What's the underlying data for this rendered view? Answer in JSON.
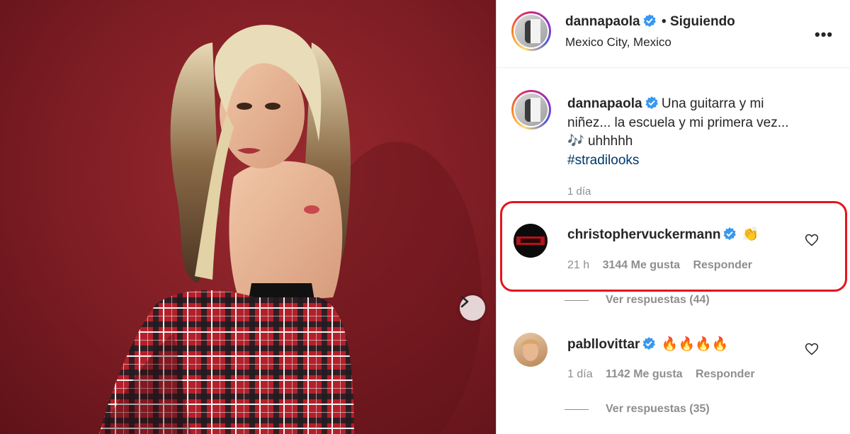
{
  "post": {
    "author": "dannapaola",
    "follow_status": "• Siguiendo",
    "location": "Mexico City, Mexico",
    "caption_lines": [
      "Una guitarra y mi",
      "niñez... la escuela y mi primera vez...",
      "uhhhhh"
    ],
    "caption_emoji": "🎶",
    "hashtag": "#stradilooks",
    "time": "1 día",
    "more_icon": "•••"
  },
  "comments": [
    {
      "username": "christophervuckermann",
      "emoji": "👏",
      "time": "21 h",
      "likes": "3144 Me gusta",
      "reply_label": "Responder",
      "view_replies": "Ver respuestas (44)"
    },
    {
      "username": "pabllovittar",
      "emoji": "🔥🔥🔥🔥",
      "time": "1 día",
      "likes": "1142 Me gusta",
      "reply_label": "Responder",
      "view_replies": "Ver respuestas (35)"
    }
  ],
  "colors": {
    "highlight": "#e3141e",
    "verified": "#3897f0",
    "hashtag": "#00376b",
    "photo_bg": "#7e1d24"
  },
  "icons": {
    "verified": "verified-badge-icon",
    "heart": "heart-icon",
    "next": "chevron-right-icon",
    "more": "more-options-icon"
  }
}
